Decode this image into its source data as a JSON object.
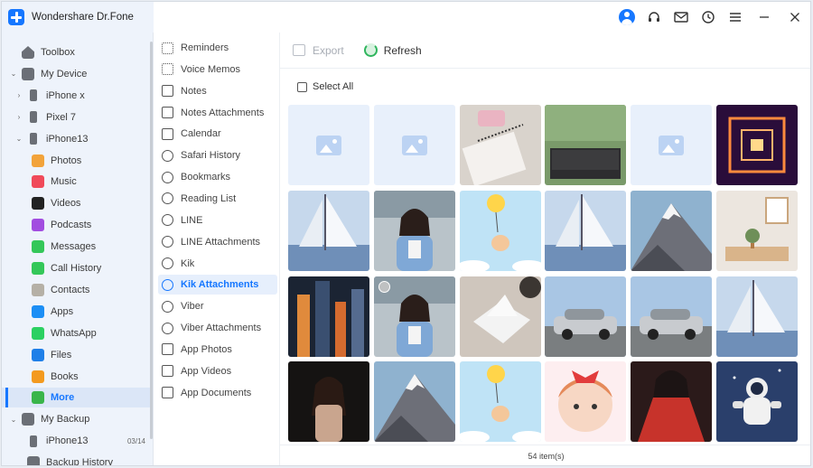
{
  "app": {
    "title": "Wondershare Dr.Fone"
  },
  "sidebar": {
    "items": [
      {
        "label": "Toolbox",
        "icon": "home-icon",
        "level": 0,
        "caret": ""
      },
      {
        "label": "My Device",
        "icon": "device-icon",
        "level": 0,
        "caret": "v"
      },
      {
        "label": "iPhone x",
        "icon": "phone-icon",
        "level": 1,
        "caret": ">"
      },
      {
        "label": "Pixel 7",
        "icon": "phone-icon",
        "level": 1,
        "caret": ">"
      },
      {
        "label": "iPhone13",
        "icon": "phone-icon",
        "level": 1,
        "caret": "v"
      },
      {
        "label": "Photos",
        "icon": "photos-icon",
        "level": 2,
        "color": "#f2a33a"
      },
      {
        "label": "Music",
        "icon": "music-icon",
        "level": 2,
        "color": "#f04a5a"
      },
      {
        "label": "Videos",
        "icon": "tv-icon",
        "level": 2,
        "color": "#222222"
      },
      {
        "label": "Podcasts",
        "icon": "podcasts-icon",
        "level": 2,
        "color": "#a24de0"
      },
      {
        "label": "Messages",
        "icon": "messages-icon",
        "level": 2,
        "color": "#34c759"
      },
      {
        "label": "Call History",
        "icon": "call-icon",
        "level": 2,
        "color": "#34c759"
      },
      {
        "label": "Contacts",
        "icon": "contacts-icon",
        "level": 2,
        "color": "#b5b0a6"
      },
      {
        "label": "Apps",
        "icon": "appstore-icon",
        "level": 2,
        "color": "#1c8ef5"
      },
      {
        "label": "WhatsApp",
        "icon": "whatsapp-icon",
        "level": 2,
        "color": "#2bd061"
      },
      {
        "label": "Files",
        "icon": "files-icon",
        "level": 2,
        "color": "#1f7fe8"
      },
      {
        "label": "Books",
        "icon": "books-icon",
        "level": 2,
        "color": "#f39a1f"
      },
      {
        "label": "More",
        "icon": "more-icon",
        "level": 2,
        "color": "#39b54a",
        "active": true
      },
      {
        "label": "My Backup",
        "icon": "backup-icon",
        "level": 0,
        "caret": "v"
      },
      {
        "label": "iPhone13",
        "icon": "phone-icon",
        "level": 1,
        "badge": "03/14"
      },
      {
        "label": "Backup History",
        "icon": "history-icon",
        "level": 1
      }
    ]
  },
  "midlist": {
    "items": [
      {
        "label": "Reminders",
        "icon": "reminders-icon",
        "shape": "list"
      },
      {
        "label": "Voice Memos",
        "icon": "voice-memos-icon",
        "shape": "wave"
      },
      {
        "label": "Notes",
        "icon": "notes-icon",
        "shape": "sq"
      },
      {
        "label": "Notes Attachments",
        "icon": "notes-attachments-icon",
        "shape": "sq"
      },
      {
        "label": "Calendar",
        "icon": "calendar-icon",
        "shape": "sq"
      },
      {
        "label": "Safari History",
        "icon": "compass-icon",
        "shape": "round"
      },
      {
        "label": "Bookmarks",
        "icon": "compass-icon",
        "shape": "round"
      },
      {
        "label": "Reading List",
        "icon": "compass-icon",
        "shape": "round"
      },
      {
        "label": "LINE",
        "icon": "chat-icon",
        "shape": "round"
      },
      {
        "label": "LINE Attachments",
        "icon": "chat-icon",
        "shape": "round"
      },
      {
        "label": "Kik",
        "icon": "chat-icon",
        "shape": "round"
      },
      {
        "label": "Kik Attachments",
        "icon": "chat-icon",
        "shape": "round",
        "active": true
      },
      {
        "label": "Viber",
        "icon": "chat-icon",
        "shape": "round"
      },
      {
        "label": "Viber Attachments",
        "icon": "chat-icon",
        "shape": "round"
      },
      {
        "label": "App Photos",
        "icon": "image-icon",
        "shape": "sq"
      },
      {
        "label": "App Videos",
        "icon": "grid-icon",
        "shape": "sq"
      },
      {
        "label": "App Documents",
        "icon": "grid-icon",
        "shape": "sq"
      }
    ]
  },
  "toolbar": {
    "export_label": "Export",
    "refresh_label": "Refresh"
  },
  "select_all_label": "Select All",
  "status": {
    "count": "54",
    "unit": "item(s)"
  },
  "thumbnails": [
    "placeholder",
    "placeholder",
    "notebook-photo",
    "laptop-photo",
    "placeholder",
    "neon-corridor-photo",
    "sailboat-photo",
    "girl-portrait-photo",
    "balloon-dog-illustration",
    "sailboat-photo",
    "snow-mountain-photo",
    "room-interior-photo",
    "city-night-photo",
    "girl-portrait-photo",
    "tissue-box-photo",
    "silver-car-photo",
    "silver-car-photo",
    "sailboat-photo",
    "woman-dark-portrait-photo",
    "snow-mountain-photo",
    "balloon-dog-illustration",
    "cartoon-girl-illustration",
    "red-dress-illustration",
    "astronaut-photo"
  ]
}
